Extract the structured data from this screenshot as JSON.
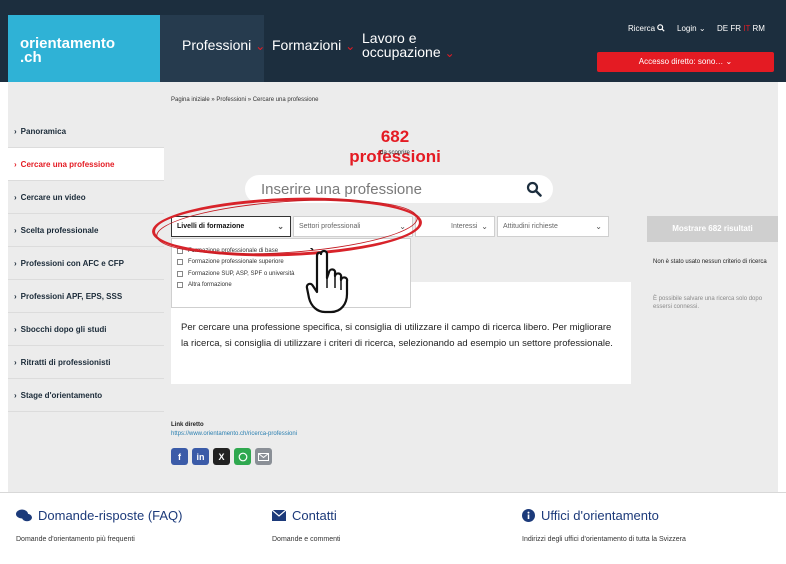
{
  "header": {
    "logo_line1": "orientamento",
    "logo_line2": ".ch",
    "nav": [
      {
        "label": "Professioni"
      },
      {
        "label": "Formazioni"
      },
      {
        "label_line1": "Lavoro e",
        "label_line2": "occupazione"
      }
    ],
    "search_link": "Ricerca",
    "login": "Login",
    "languages": [
      "DE",
      "FR",
      "IT",
      "RM"
    ],
    "direct_access": "Accesso diretto: sono…"
  },
  "breadcrumb": "Pagina iniziale » Professioni » Cercare una professione",
  "sidebar": {
    "items": [
      {
        "label": "Panoramica"
      },
      {
        "label": "Cercare una professione"
      },
      {
        "label": "Cercare un video"
      },
      {
        "label": "Scelta professionale"
      },
      {
        "label": "Professioni con AFC e CFP"
      },
      {
        "label": "Professioni APF, EPS, SSS"
      },
      {
        "label": "Sbocchi dopo gli studi"
      },
      {
        "label": "Ritratti di professionisti"
      },
      {
        "label": "Stage d'orientamento"
      }
    ]
  },
  "main": {
    "count_label": "682 professioni",
    "count_sub": "da scoprire",
    "search_placeholder": "Inserire una professione",
    "filters": {
      "levels": "Livelli di formazione",
      "sectors": "Settori professionali",
      "interests": "Interessi",
      "skills": "Attitudini richieste"
    },
    "dropdown_options": [
      "Formazione professionale di base",
      "Formazione professionale superiore",
      "Formazione SUP, ASP, SPF o università",
      "Altra formazione"
    ],
    "info_text": "Per cercare una professione specifica, si consiglia di utilizzare il campo di ricerca libero. Per migliorare la ricerca, si consiglia di utilizzare i criteri di ricerca, selezionando ad esempio un settore professionale.",
    "show_results": "Mostrare 682 risultati",
    "no_criteria": "Non è stato usato nessun criterio di ricerca",
    "save_hint": "È possibile salvare una ricerca solo dopo essersi connessi.",
    "link_title": "Link diretto",
    "link_url": "https://www.orientamento.ch/ricerca-professioni"
  },
  "footer": {
    "faq_title": "Domande-risposte (FAQ)",
    "faq_sub": "Domande d'orientamento più frequenti",
    "contact_title": "Contatti",
    "contact_sub": "Domande e commenti",
    "offices_title": "Uffici d'orientamento",
    "offices_sub": "Indirizzi degli uffici d'orientamento di tutta la Svizzera"
  },
  "colors": {
    "brand_red": "#e41b23",
    "brand_cyan": "#2fb2d6",
    "header_dark": "#1c2e3e",
    "footer_blue": "#1c3a7a"
  }
}
